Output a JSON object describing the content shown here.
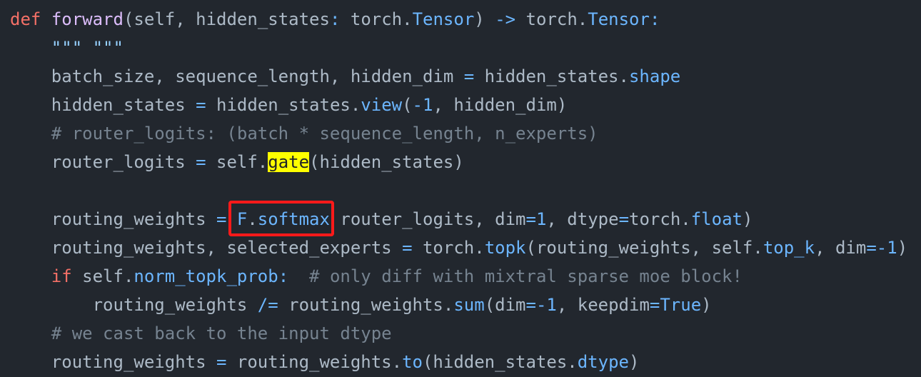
{
  "code": {
    "line1": {
      "kw_def": "def",
      "fname": "forward",
      "open_paren": "(",
      "p1": "self, hidden_states",
      "colon1": ":",
      "t1a": " torch.",
      "t1b": "Tensor",
      "close_paren": ")",
      "arrow": "->",
      "t2a": " torch.",
      "t2b": "Tensor",
      "colon2": ":"
    },
    "line2": {
      "docstring": "\"\"\" \"\"\""
    },
    "line3": {
      "lhs": "batch_size, sequence_length, hidden_dim ",
      "eq": "=",
      "rhs": " hidden_states.",
      "attr": "shape"
    },
    "line4": {
      "lhs": "hidden_states ",
      "eq": "=",
      "rhs": " hidden_states.",
      "fn": "view",
      "args_open": "(",
      "neg": "-1",
      "args_rest": ", hidden_dim)"
    },
    "line5": {
      "comment": "# router_logits: (batch * sequence_length, n_experts)"
    },
    "line6": {
      "lhs": "router_logits ",
      "eq": "=",
      "rhs": " self.",
      "fn": "gate",
      "args": "(hidden_states)"
    },
    "line7": {
      "lhs": "routing_weights ",
      "eq": "=",
      "mod": "F",
      "dot": ".",
      "fn": "softmax",
      "args_a": " router_logits, dim",
      "eq2": "=",
      "num1": "1",
      "args_b": ", dtype",
      "eq3": "=",
      "args_c": "torch.",
      "attr": "float",
      "close": ")"
    },
    "line8": {
      "lhs": "routing_weights, selected_experts ",
      "eq": "=",
      "rhs": " torch.",
      "fn": "topk",
      "args_a": "(routing_weights, self.",
      "attr": "top_k",
      "args_b": ", dim",
      "eq2": "=",
      "neg": "-1",
      "close": ")"
    },
    "line9": {
      "kw_if": "if",
      "rhs": " self.",
      "attr": "norm_topk_prob",
      "colon": ":",
      "comment": "  # only diff with mixtral sparse moe block!"
    },
    "line10": {
      "lhs": "routing_weights ",
      "op": "/=",
      "rhs": " routing_weights.",
      "fn": "sum",
      "args_a": "(dim",
      "eq2": "=",
      "neg": "-1",
      "args_b": ", keepdim",
      "eq3": "=",
      "bool": "True",
      "close": ")"
    },
    "line11": {
      "comment": "# we cast back to the input dtype"
    },
    "line12": {
      "lhs": "routing_weights ",
      "eq": "=",
      "rhs": " routing_weights.",
      "fn": "to",
      "args_a": "(hidden_states.",
      "attr": "dtype",
      "close": ")"
    }
  },
  "annotations": {
    "highlight_color": "#ffff00",
    "box_color": "#ff1a1a",
    "highlighted_token": "gate",
    "boxed_token": "F.softmax"
  }
}
